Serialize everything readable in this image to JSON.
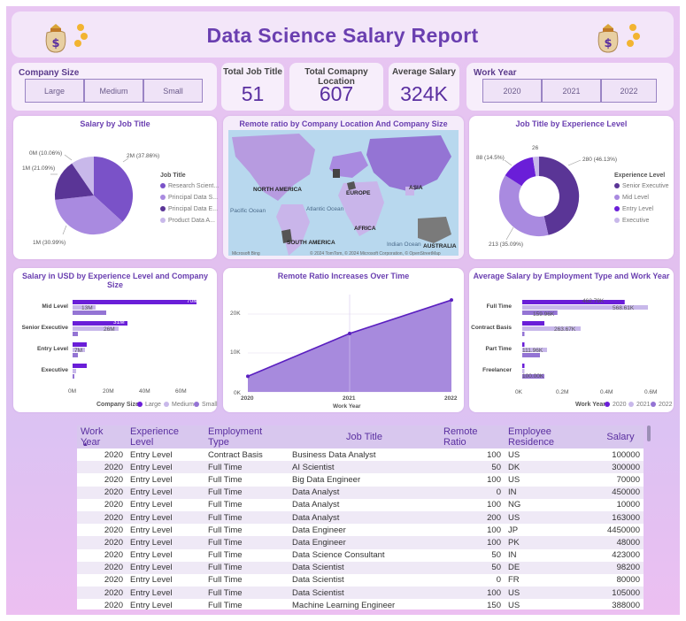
{
  "report": {
    "title": "Data Science Salary Report"
  },
  "slicers": {
    "company_size": {
      "title": "Company Size",
      "options": [
        "Large",
        "Medium",
        "Small"
      ]
    },
    "work_year": {
      "title": "Work Year",
      "options": [
        "2020",
        "2021",
        "2022"
      ]
    }
  },
  "kpis": [
    {
      "label": "Total Job Title",
      "value": "51"
    },
    {
      "label": "Total Comapny Location",
      "value": "607"
    },
    {
      "label": "Average Salary",
      "value": "324K"
    }
  ],
  "colors": {
    "dark": "#5a3596",
    "mid": "#7a52c8",
    "light": "#a98ae0",
    "pale": "#c8b8ea",
    "accent": "#6a3fb0"
  },
  "chart_data": [
    {
      "type": "pie",
      "title": "Salary by Job Title",
      "legend_title": "Job Title",
      "labels": [
        "Research Scient...",
        "Principal Data S...",
        "Principal Data E...",
        "Product Data A..."
      ],
      "values": [
        2,
        1,
        1,
        0
      ],
      "data_labels": [
        "2M (37.86%)",
        "1M (30.99%)",
        "1M (21.09%)",
        "0M (10.06%)"
      ]
    },
    {
      "type": "map",
      "title": "Remote ratio by Company Location And Company Size",
      "regions": [
        "NORTH AMERICA",
        "EUROPE",
        "ASIA",
        "AFRICA",
        "SOUTH AMERICA",
        "AUSTRALIA",
        "Atlantic Ocean",
        "Indian Ocean",
        "Pacific Ocean"
      ],
      "footer": "© 2024 TomTom, © 2024 Microsoft Corporation, © OpenStreetMap",
      "brand": "Microsoft Bing"
    },
    {
      "type": "pie",
      "title": "Job Title by Experience Level",
      "legend_title": "Experience Level",
      "labels": [
        "Senior Executive",
        "Mid Level",
        "Entry Level",
        "Executive"
      ],
      "values": [
        280,
        213,
        88,
        26
      ],
      "data_labels": [
        "280 (46.13%)",
        "213 (35.09%)",
        "88 (14.5%)",
        "26"
      ]
    },
    {
      "type": "bar",
      "title": "Salary in USD by Experience Level and Company Size",
      "categories": [
        "Mid Level",
        "Senior Executive",
        "Entry Level",
        "Executive"
      ],
      "series": [
        {
          "name": "Large",
          "values": [
            70,
            31,
            8,
            8
          ]
        },
        {
          "name": "Medium",
          "values": [
            13,
            26,
            7,
            2
          ]
        },
        {
          "name": "Small",
          "values": [
            19,
            3,
            3,
            1
          ]
        }
      ],
      "data_labels": [
        "70M",
        "13M",
        "31M",
        "26M",
        "7M"
      ],
      "xticks": [
        "0M",
        "20M",
        "40M",
        "60M"
      ],
      "legend_title": "Company Size",
      "xlim": [
        0,
        70
      ]
    },
    {
      "type": "area",
      "title": "Remote Ratio Increases Over Time",
      "x": [
        "2020",
        "2021",
        "2022"
      ],
      "values": [
        4000,
        15000,
        23600
      ],
      "yticks": [
        "0K",
        "10K",
        "20K"
      ],
      "xlabel": "Work Year",
      "ylim": [
        0,
        25000
      ]
    },
    {
      "type": "bar",
      "title": "Average Salary by Employment Type and Work Year",
      "categories": [
        "Full Time",
        "Contract Basis",
        "Part Time",
        "Freelancer"
      ],
      "series": [
        {
          "name": "2020",
          "values": [
            0.463,
            0.1,
            0.01,
            0.01
          ]
        },
        {
          "name": "2021",
          "values": [
            0.568,
            0.264,
            0.112,
            0.01
          ]
        },
        {
          "name": "2022",
          "values": [
            0.159,
            0.01,
            0.08,
            0.1
          ]
        }
      ],
      "data_labels": [
        "462.79K",
        "568.61K",
        "159.96K",
        "263.67K",
        "111.96K",
        "100.00K"
      ],
      "xticks": [
        "0K",
        "0.2M",
        "0.4M",
        "0.6M"
      ],
      "legend_title": "Work Year",
      "xlim": [
        0,
        0.7
      ]
    }
  ],
  "table": {
    "columns": [
      "Work Year",
      "Experience Level",
      "Employment Type",
      "Job Title",
      "Remote Ratio",
      "Employee Residence",
      "Salary"
    ],
    "rows": [
      [
        "2020",
        "Entry Level",
        "Contract Basis",
        "Business Data Analyst",
        "100",
        "US",
        "100000"
      ],
      [
        "2020",
        "Entry Level",
        "Full Time",
        "AI Scientist",
        "50",
        "DK",
        "300000"
      ],
      [
        "2020",
        "Entry Level",
        "Full Time",
        "Big Data Engineer",
        "100",
        "US",
        "70000"
      ],
      [
        "2020",
        "Entry Level",
        "Full Time",
        "Data Analyst",
        "0",
        "IN",
        "450000"
      ],
      [
        "2020",
        "Entry Level",
        "Full Time",
        "Data Analyst",
        "100",
        "NG",
        "10000"
      ],
      [
        "2020",
        "Entry Level",
        "Full Time",
        "Data Analyst",
        "200",
        "US",
        "163000"
      ],
      [
        "2020",
        "Entry Level",
        "Full Time",
        "Data Engineer",
        "100",
        "JP",
        "4450000"
      ],
      [
        "2020",
        "Entry Level",
        "Full Time",
        "Data Engineer",
        "100",
        "PK",
        "48000"
      ],
      [
        "2020",
        "Entry Level",
        "Full Time",
        "Data Science Consultant",
        "50",
        "IN",
        "423000"
      ],
      [
        "2020",
        "Entry Level",
        "Full Time",
        "Data Scientist",
        "50",
        "DE",
        "98200"
      ],
      [
        "2020",
        "Entry Level",
        "Full Time",
        "Data Scientist",
        "0",
        "FR",
        "80000"
      ],
      [
        "2020",
        "Entry Level",
        "Full Time",
        "Data Scientist",
        "100",
        "US",
        "105000"
      ],
      [
        "2020",
        "Entry Level",
        "Full Time",
        "Machine Learning Engineer",
        "150",
        "US",
        "388000"
      ]
    ]
  }
}
